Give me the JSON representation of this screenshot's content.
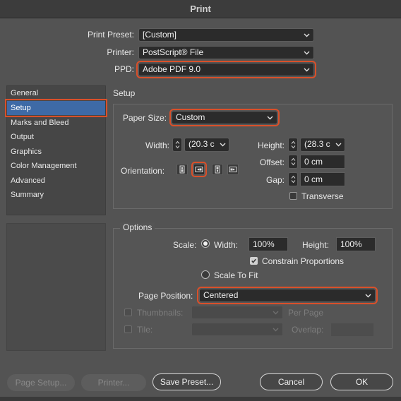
{
  "window": {
    "title": "Print"
  },
  "header": {
    "print_preset_label": "Print Preset:",
    "print_preset_value": "[Custom]",
    "printer_label": "Printer:",
    "printer_value": "PostScript® File",
    "ppd_label": "PPD:",
    "ppd_value": "Adobe PDF 9.0"
  },
  "sidebar": {
    "items": [
      {
        "label": "General",
        "selected": false
      },
      {
        "label": "Setup",
        "selected": true
      },
      {
        "label": "Marks and Bleed",
        "selected": false
      },
      {
        "label": "Output",
        "selected": false
      },
      {
        "label": "Graphics",
        "selected": false
      },
      {
        "label": "Color Management",
        "selected": false
      },
      {
        "label": "Advanced",
        "selected": false
      },
      {
        "label": "Summary",
        "selected": false
      }
    ]
  },
  "setup": {
    "title": "Setup",
    "paper_size_label": "Paper Size:",
    "paper_size_value": "Custom",
    "width_label": "Width:",
    "width_value": "(20.3 c",
    "height_label": "Height:",
    "height_value": "(28.3 c",
    "offset_label": "Offset:",
    "offset_value": "0 cm",
    "gap_label": "Gap:",
    "gap_value": "0 cm",
    "orientation_label": "Orientation:",
    "transverse_label": "Transverse",
    "transverse_checked": false,
    "orientation_icons": [
      "portrait-icon",
      "landscape-icon",
      "reverse-portrait-icon",
      "reverse-landscape-icon"
    ],
    "orientation_selected": "landscape-icon"
  },
  "options": {
    "title": "Options",
    "scale_label": "Scale:",
    "scale_width_label": "Width:",
    "scale_width_value": "100%",
    "scale_height_label": "Height:",
    "scale_height_value": "100%",
    "constrain_label": "Constrain Proportions",
    "constrain_checked": true,
    "scale_to_fit_label": "Scale To Fit",
    "scale_mode": "width",
    "page_position_label": "Page Position:",
    "page_position_value": "Centered",
    "thumbnails_label": "Thumbnails:",
    "thumbnails_value": "",
    "per_page_label": "Per Page",
    "tile_label": "Tile:",
    "tile_value": "",
    "overlap_label": "Overlap:",
    "overlap_value": ""
  },
  "footer": {
    "page_setup_label": "Page Setup...",
    "printer_label": "Printer...",
    "save_preset_label": "Save Preset...",
    "cancel_label": "Cancel",
    "ok_label": "OK"
  },
  "colors": {
    "highlight": "#d9502a",
    "selection": "#3e6aa6",
    "background": "#535353"
  }
}
